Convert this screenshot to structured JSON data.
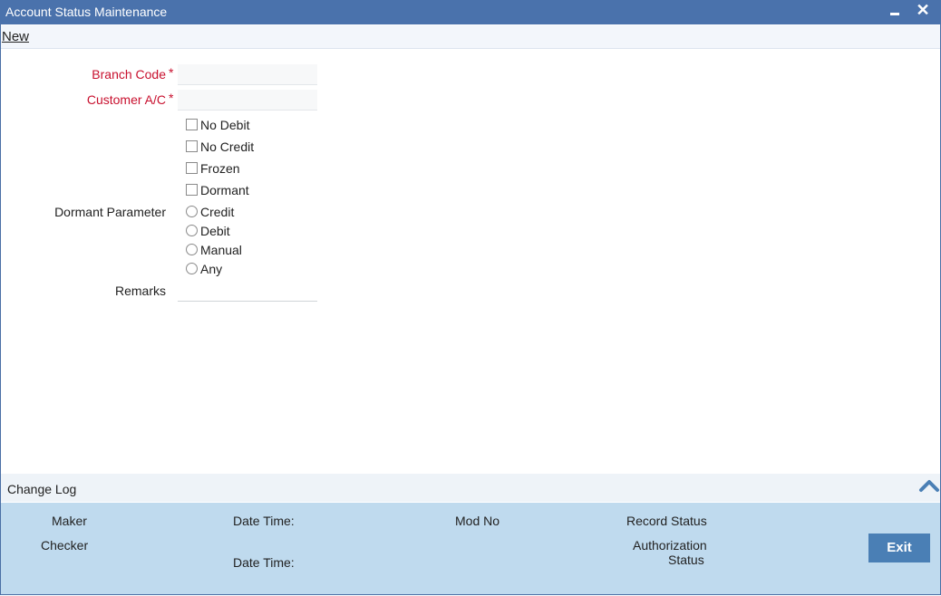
{
  "window": {
    "title": "Account Status Maintenance",
    "close_glyph": "✕"
  },
  "toolbar": {
    "new_label": "New"
  },
  "form": {
    "branch_code": {
      "label": "Branch Code",
      "required_mark": "*",
      "value": ""
    },
    "customer_ac": {
      "label": "Customer A/C",
      "required_mark": "*",
      "value": ""
    },
    "checkboxes": [
      {
        "label": "No Debit",
        "checked": false
      },
      {
        "label": "No Credit",
        "checked": false
      },
      {
        "label": "Frozen",
        "checked": false
      },
      {
        "label": "Dormant",
        "checked": false
      }
    ],
    "dormant_parameter": {
      "label": "Dormant Parameter",
      "options": [
        {
          "label": "Credit",
          "selected": false
        },
        {
          "label": "Debit",
          "selected": false
        },
        {
          "label": "Manual",
          "selected": false
        },
        {
          "label": "Any",
          "selected": false
        }
      ]
    },
    "remarks": {
      "label": "Remarks",
      "value": ""
    }
  },
  "change_log": {
    "label": "Change Log",
    "maker": "Maker",
    "checker": "Checker",
    "date_time_1": "Date Time:",
    "date_time_2": "Date Time:",
    "mod_no": "Mod No",
    "record_status": "Record Status",
    "authorization_status_line1": "Authorization",
    "authorization_status_line2": "Status"
  },
  "buttons": {
    "exit_label": "Exit"
  },
  "colors": {
    "titlebar": "#4a72ac",
    "required": "#c8102e",
    "footer": "#bfdaee",
    "exit_button": "#4a7fb5"
  }
}
